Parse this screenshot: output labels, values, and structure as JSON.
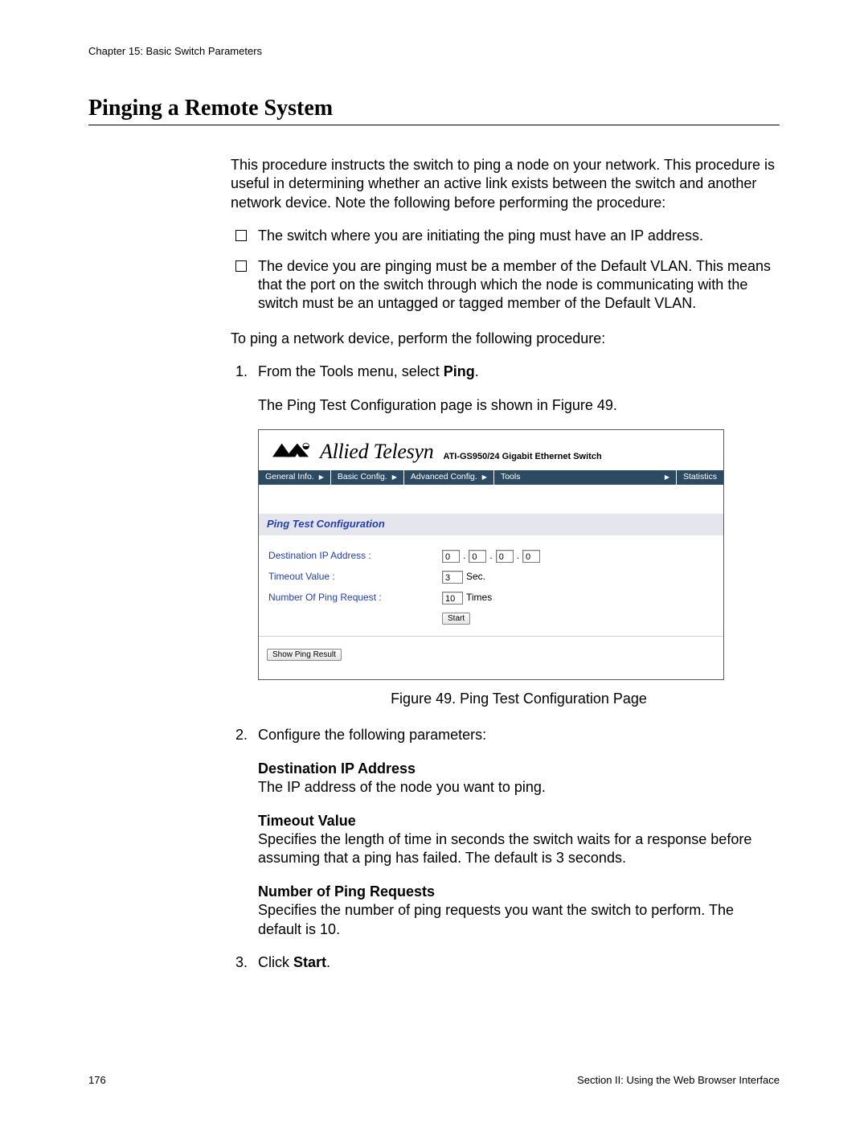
{
  "header": {
    "chapter": "Chapter 15: Basic Switch Parameters"
  },
  "title": "Pinging a Remote System",
  "intro": "This procedure instructs the switch to ping a node on your network. This procedure is useful in determining whether an active link exists between the switch and another network device. Note the following before performing the procedure:",
  "checks": [
    "The switch where you are initiating the ping must have an IP address.",
    "The device you are pinging must be a member of the Default VLAN. This means that the port on the switch through which the node is communicating with the switch must be an untagged or tagged member of the Default VLAN."
  ],
  "lead2": "To ping a network device, perform the following procedure:",
  "step1": {
    "num": "1.",
    "pre": "From the Tools menu, select ",
    "bold": "Ping",
    "post": ".",
    "follow": "The Ping Test Configuration page is shown in Figure 49."
  },
  "screenshot": {
    "brand": "Allied Telesyn",
    "model": "ATI-GS950/24 Gigabit Ethernet Switch",
    "nav": [
      "General Info.",
      "Basic Config.",
      "Advanced Config.",
      "Tools",
      "Statistics"
    ],
    "section": "Ping Test Configuration",
    "rows": {
      "ip_label": "Destination IP Address :",
      "ip": [
        "0",
        "0",
        "0",
        "0"
      ],
      "timeout_label": "Timeout Value :",
      "timeout_val": "3",
      "timeout_unit": "Sec.",
      "count_label": "Number Of Ping Request :",
      "count_val": "10",
      "count_unit": "Times"
    },
    "start_btn": "Start",
    "show_btn": "Show Ping Result"
  },
  "caption": "Figure 49. Ping Test Configuration Page",
  "step2": {
    "num": "2.",
    "text": "Configure the following parameters:",
    "defs": [
      {
        "term": "Destination IP Address",
        "desc": "The IP address of the node you want to ping."
      },
      {
        "term": "Timeout Value",
        "desc": "Specifies the length of time in seconds the switch waits for a response before assuming that a ping has failed. The default is 3 seconds."
      },
      {
        "term": "Number of Ping Requests",
        "desc": "Specifies the number of ping requests you want the switch to perform. The default is 10."
      }
    ]
  },
  "step3": {
    "num": "3.",
    "pre": "Click ",
    "bold": "Start",
    "post": "."
  },
  "footer": {
    "page": "176",
    "section": "Section II: Using the Web Browser Interface"
  }
}
